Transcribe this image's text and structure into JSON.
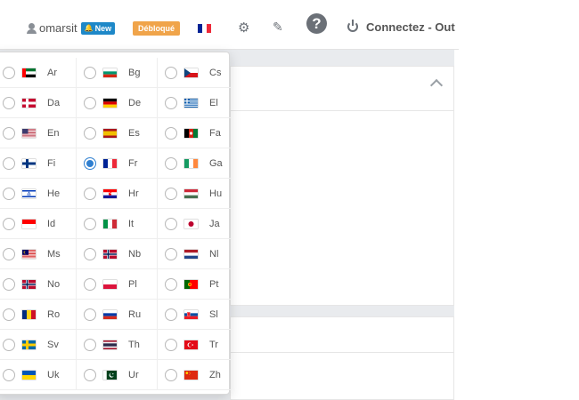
{
  "nav": {
    "username": "omarsit",
    "new_badge": "New",
    "unlocked_badge": "Débloqué",
    "logout_label": "Connectez - Out",
    "help_glyph": "?",
    "icons": {
      "user": "user-icon",
      "bell": "bell-icon",
      "flag": "flag-fr",
      "cogs": "cogs-icon",
      "brush": "brush-icon",
      "help": "question-circle-icon",
      "power": "power-icon"
    }
  },
  "languages": [
    {
      "code": "Ar",
      "flag": "ae"
    },
    {
      "code": "Bg",
      "flag": "bg"
    },
    {
      "code": "Cs",
      "flag": "cz"
    },
    {
      "code": "Da",
      "flag": "dk"
    },
    {
      "code": "De",
      "flag": "de"
    },
    {
      "code": "El",
      "flag": "gr"
    },
    {
      "code": "En",
      "flag": "us"
    },
    {
      "code": "Es",
      "flag": "es"
    },
    {
      "code": "Fa",
      "flag": "af"
    },
    {
      "code": "Fi",
      "flag": "fi"
    },
    {
      "code": "Fr",
      "flag": "fr",
      "selected": true
    },
    {
      "code": "Ga",
      "flag": "ie"
    },
    {
      "code": "He",
      "flag": "il"
    },
    {
      "code": "Hr",
      "flag": "hr"
    },
    {
      "code": "Hu",
      "flag": "hu"
    },
    {
      "code": "Id",
      "flag": "id"
    },
    {
      "code": "It",
      "flag": "it"
    },
    {
      "code": "Ja",
      "flag": "jp"
    },
    {
      "code": "Ms",
      "flag": "my"
    },
    {
      "code": "Nb",
      "flag": "no"
    },
    {
      "code": "Nl",
      "flag": "nl"
    },
    {
      "code": "No",
      "flag": "no"
    },
    {
      "code": "Pl",
      "flag": "pl"
    },
    {
      "code": "Pt",
      "flag": "pt"
    },
    {
      "code": "Ro",
      "flag": "ro"
    },
    {
      "code": "Ru",
      "flag": "ru"
    },
    {
      "code": "Sl",
      "flag": "sk"
    },
    {
      "code": "Sv",
      "flag": "se"
    },
    {
      "code": "Th",
      "flag": "th"
    },
    {
      "code": "Tr",
      "flag": "tr"
    },
    {
      "code": "Uk",
      "flag": "ua"
    },
    {
      "code": "Ur",
      "flag": "pk"
    },
    {
      "code": "Zh",
      "flag": "cn"
    }
  ],
  "colors": {
    "accent": "#2f7fd0",
    "new_badge": "#1e88c8",
    "unlocked_badge": "#f0a44a"
  }
}
